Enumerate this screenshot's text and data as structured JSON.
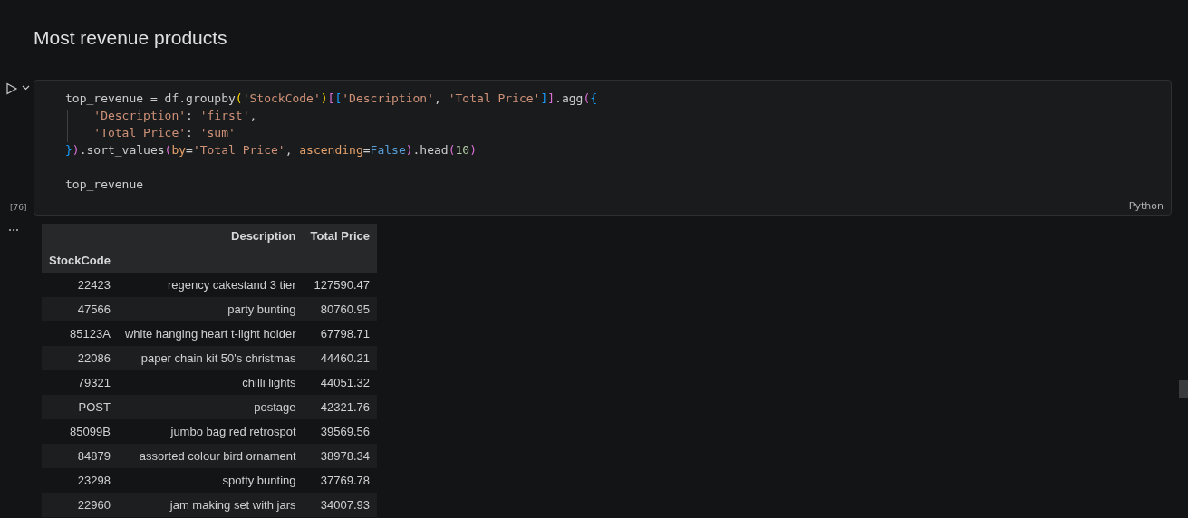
{
  "heading": "Most revenue products",
  "code_cell": {
    "execution_count": "[76]",
    "language": "Python",
    "lines": [
      {
        "gap_before": false,
        "tokens": [
          {
            "text": "top_revenue = df.groupby",
            "kind": "plain"
          },
          {
            "text": "(",
            "kind": "bracket1"
          },
          {
            "text": "'StockCode'",
            "kind": "string"
          },
          {
            "text": ")",
            "kind": "bracket1"
          },
          {
            "text": "[",
            "kind": "bracket2"
          },
          {
            "text": "[",
            "kind": "bracket3"
          },
          {
            "text": "'Description'",
            "kind": "string"
          },
          {
            "text": ", ",
            "kind": "plain"
          },
          {
            "text": "'Total Price'",
            "kind": "string"
          },
          {
            "text": "]",
            "kind": "bracket3"
          },
          {
            "text": "]",
            "kind": "bracket2"
          },
          {
            "text": ".agg",
            "kind": "plain"
          },
          {
            "text": "(",
            "kind": "bracket2"
          },
          {
            "text": "{",
            "kind": "bracket3"
          }
        ]
      },
      {
        "gap_before": false,
        "tokens": [
          {
            "text": "    'Description'",
            "kind": "string"
          },
          {
            "text": ": ",
            "kind": "plain"
          },
          {
            "text": "'first'",
            "kind": "string"
          },
          {
            "text": ",",
            "kind": "plain"
          }
        ]
      },
      {
        "gap_before": false,
        "tokens": [
          {
            "text": "    'Total Price'",
            "kind": "string"
          },
          {
            "text": ": ",
            "kind": "plain"
          },
          {
            "text": "'sum'",
            "kind": "string"
          }
        ]
      },
      {
        "gap_before": false,
        "tokens": [
          {
            "text": "}",
            "kind": "bracket3"
          },
          {
            "text": ")",
            "kind": "bracket2"
          },
          {
            "text": ".sort_values",
            "kind": "plain"
          },
          {
            "text": "(",
            "kind": "bracket2"
          },
          {
            "text": "by",
            "kind": "param"
          },
          {
            "text": "=",
            "kind": "plain"
          },
          {
            "text": "'Total Price'",
            "kind": "string"
          },
          {
            "text": ", ",
            "kind": "plain"
          },
          {
            "text": "ascending",
            "kind": "param"
          },
          {
            "text": "=",
            "kind": "plain"
          },
          {
            "text": "False",
            "kind": "constant"
          },
          {
            "text": ")",
            "kind": "bracket2"
          },
          {
            "text": ".head",
            "kind": "plain"
          },
          {
            "text": "(",
            "kind": "bracket2"
          },
          {
            "text": "10",
            "kind": "number"
          },
          {
            "text": ")",
            "kind": "bracket2"
          }
        ]
      },
      {
        "gap_before": true,
        "tokens": [
          {
            "text": "top_revenue",
            "kind": "plain"
          }
        ]
      }
    ]
  },
  "output": {
    "columns": [
      "Description",
      "Total Price"
    ],
    "index_name": "StockCode",
    "rows": [
      {
        "index": "22423",
        "cells": [
          "regency cakestand 3 tier",
          "127590.47"
        ]
      },
      {
        "index": "47566",
        "cells": [
          "party bunting",
          "80760.95"
        ]
      },
      {
        "index": "85123A",
        "cells": [
          "white hanging heart t-light holder",
          "67798.71"
        ]
      },
      {
        "index": "22086",
        "cells": [
          "paper chain kit 50's christmas",
          "44460.21"
        ]
      },
      {
        "index": "79321",
        "cells": [
          "chilli lights",
          "44051.32"
        ]
      },
      {
        "index": "POST",
        "cells": [
          "postage",
          "42321.76"
        ]
      },
      {
        "index": "85099B",
        "cells": [
          "jumbo bag red retrospot",
          "39569.56"
        ]
      },
      {
        "index": "84879",
        "cells": [
          "assorted colour bird ornament",
          "38978.34"
        ]
      },
      {
        "index": "23298",
        "cells": [
          "spotty bunting",
          "37769.78"
        ]
      },
      {
        "index": "22960",
        "cells": [
          "jam making set with jars",
          "34007.93"
        ]
      }
    ]
  }
}
